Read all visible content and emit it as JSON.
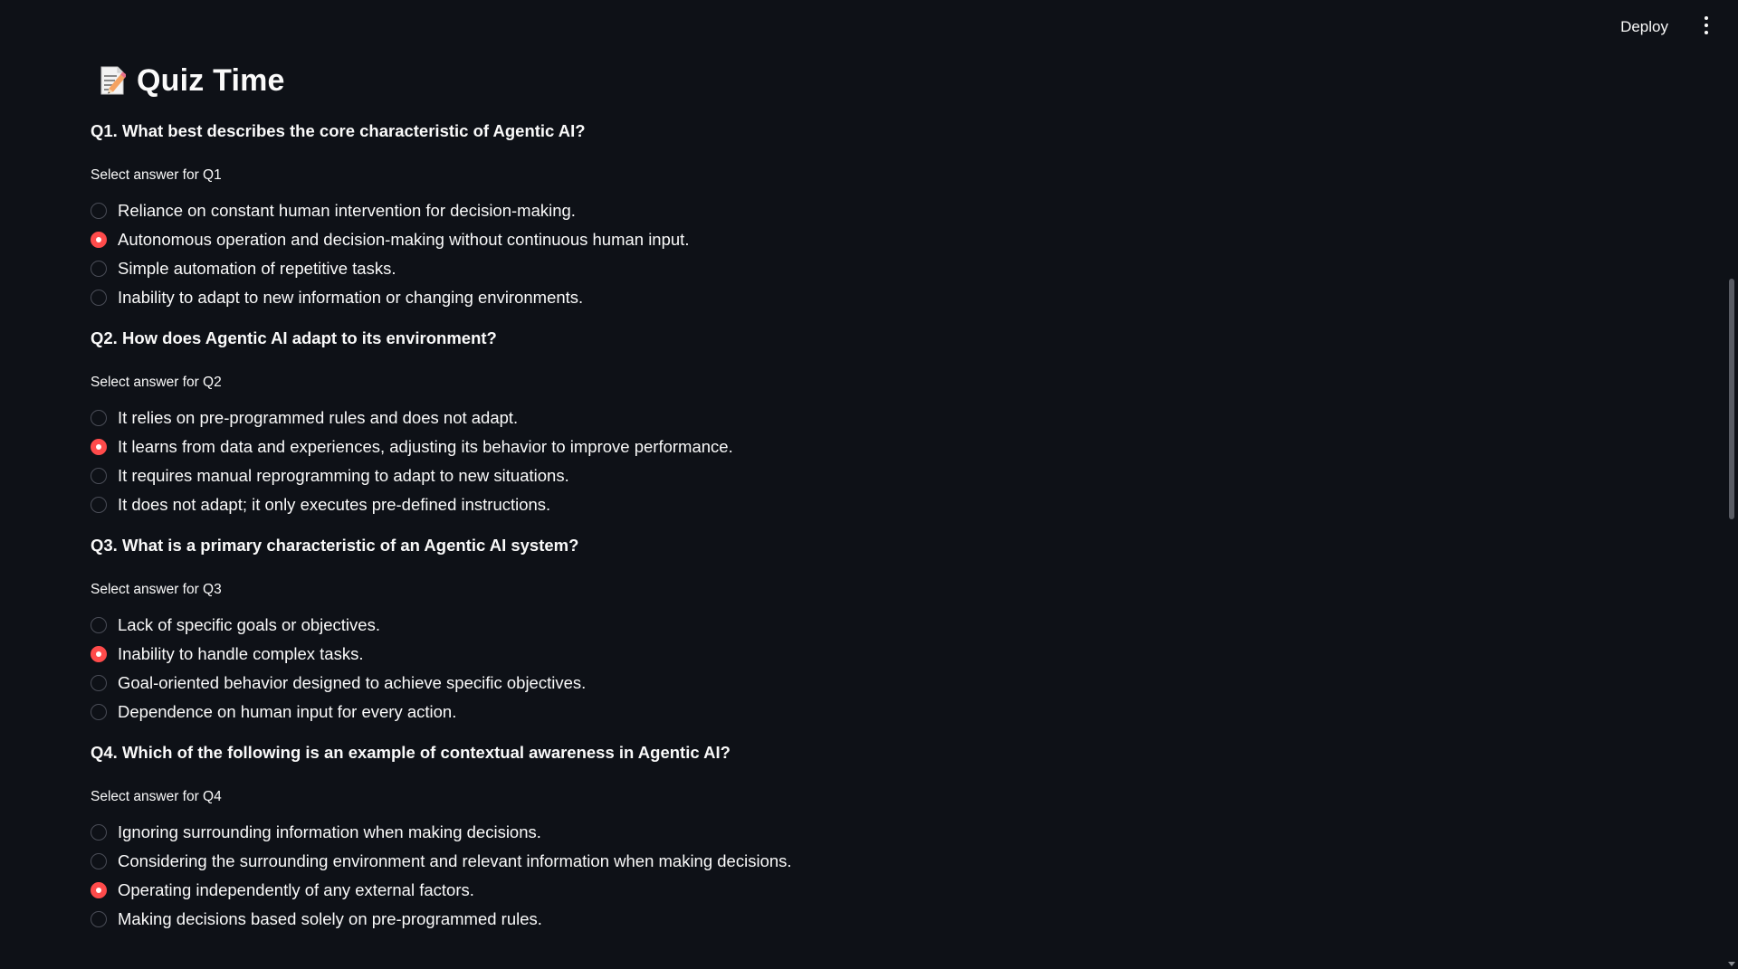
{
  "header": {
    "deploy_label": "Deploy",
    "menu_icon": "more-vertical-icon"
  },
  "page": {
    "title": "Quiz Time",
    "title_icon": "memo-icon"
  },
  "questions": [
    {
      "text": "Q1. What best describes the core characteristic of Agentic AI?",
      "label": "Select answer for Q1",
      "selected": 1,
      "options": [
        "Reliance on constant human intervention for decision-making.",
        "Autonomous operation and decision-making without continuous human input.",
        "Simple automation of repetitive tasks.",
        "Inability to adapt to new information or changing environments."
      ]
    },
    {
      "text": "Q2. How does Agentic AI adapt to its environment?",
      "label": "Select answer for Q2",
      "selected": 1,
      "options": [
        "It relies on pre-programmed rules and does not adapt.",
        "It learns from data and experiences, adjusting its behavior to improve performance.",
        "It requires manual reprogramming to adapt to new situations.",
        "It does not adapt; it only executes pre-defined instructions."
      ]
    },
    {
      "text": "Q3. What is a primary characteristic of an Agentic AI system?",
      "label": "Select answer for Q3",
      "selected": 1,
      "options": [
        "Lack of specific goals or objectives.",
        "Inability to handle complex tasks.",
        "Goal-oriented behavior designed to achieve specific objectives.",
        "Dependence on human input for every action."
      ]
    },
    {
      "text": "Q4. Which of the following is an example of contextual awareness in Agentic AI?",
      "label": "Select answer for Q4",
      "selected": 2,
      "options": [
        "Ignoring surrounding information when making decisions.",
        "Considering the surrounding environment and relevant information when making decisions.",
        "Operating independently of any external factors.",
        "Making decisions based solely on pre-programmed rules."
      ]
    }
  ],
  "colors": {
    "background": "#0e1117",
    "accent": "#ff4b4b",
    "text": "#fafafa"
  }
}
